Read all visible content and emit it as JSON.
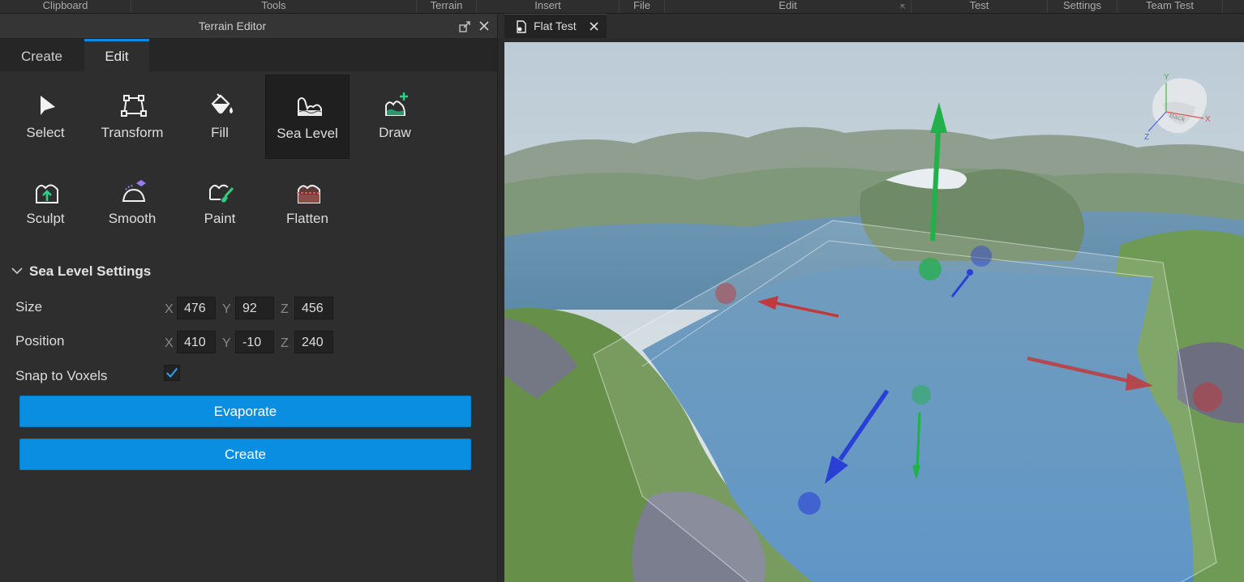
{
  "ribbon": {
    "sections": [
      "Clipboard",
      "Tools",
      "Terrain",
      "Insert",
      "File",
      "Edit",
      "Test",
      "Settings",
      "Team Test"
    ]
  },
  "panel": {
    "title": "Terrain Editor",
    "tabs": [
      "Create",
      "Edit"
    ],
    "active_tab": "Edit",
    "tools_row1": [
      {
        "label": "Select",
        "icon": "cursor-arrow-icon"
      },
      {
        "label": "Transform",
        "icon": "transform-box-icon"
      },
      {
        "label": "Fill",
        "icon": "paint-bucket-icon"
      },
      {
        "label": "Sea Level",
        "icon": "sea-level-icon"
      },
      {
        "label": "Draw",
        "icon": "draw-terrain-icon"
      }
    ],
    "tools_row2": [
      {
        "label": "Sculpt",
        "icon": "sculpt-icon"
      },
      {
        "label": "Smooth",
        "icon": "smooth-icon"
      },
      {
        "label": "Paint",
        "icon": "paint-brush-icon"
      },
      {
        "label": "Flatten",
        "icon": "flatten-icon"
      }
    ],
    "selected_tool": "Sea Level"
  },
  "settings": {
    "title": "Sea Level Settings",
    "size_label": "Size",
    "position_label": "Position",
    "axes": {
      "x": "X",
      "y": "Y",
      "z": "Z"
    },
    "size": {
      "x": "476",
      "y": "92",
      "z": "456"
    },
    "position": {
      "x": "410",
      "y": "-10",
      "z": "240"
    },
    "snap_label": "Snap to Voxels",
    "snap_checked": true,
    "evaporate_label": "Evaporate",
    "create_label": "Create"
  },
  "viewport": {
    "tab_label": "Flat Test",
    "view_cube_face": "Back",
    "axis_labels": {
      "x": "X",
      "y": "Y",
      "z": "Z"
    }
  },
  "colors": {
    "accent": "#0a8ee2",
    "gizmo_x": "#c0393b",
    "gizmo_y": "#22b04a",
    "gizmo_z": "#2a3fd6"
  }
}
